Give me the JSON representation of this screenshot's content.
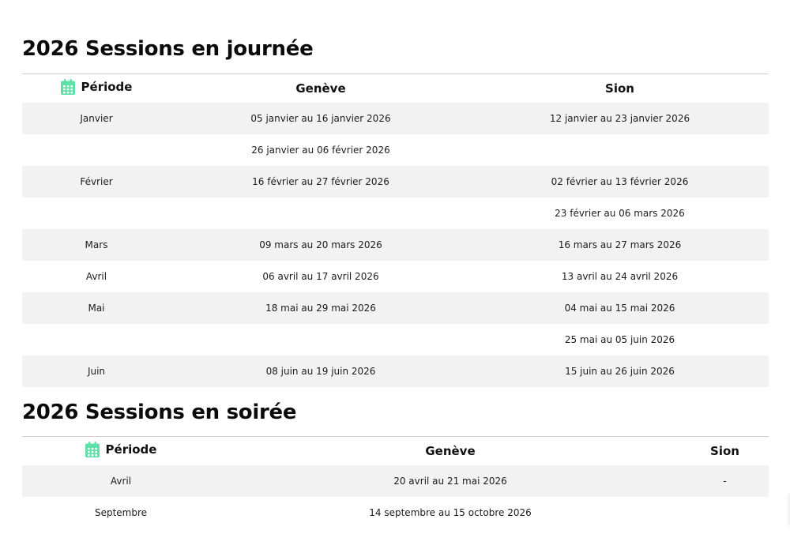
{
  "colors": {
    "accent": "#5fe0a8",
    "row_stripe": "#f2f2f2",
    "rule": "#cfcfcf"
  },
  "day": {
    "title": "2026 Sessions en journée",
    "headers": {
      "icon": "calendar-icon",
      "period": "Période",
      "geneve": "Genève",
      "sion": "Sion"
    },
    "rows": [
      [
        "Janvier",
        "05 janvier au 16 janvier 2026",
        "12 janvier au 23 janvier 2026"
      ],
      [
        "",
        "26 janvier au 06 février 2026",
        ""
      ],
      [
        "Février",
        "16 février au 27 février 2026",
        "02 février au 13 février 2026"
      ],
      [
        "",
        "",
        "23 février au 06 mars 2026"
      ],
      [
        "Mars",
        "09 mars au 20 mars 2026",
        "16 mars au 27 mars 2026"
      ],
      [
        "Avril",
        "06 avril au 17 avril 2026",
        "13 avril au 24 avril 2026"
      ],
      [
        "Mai",
        "18 mai au 29 mai 2026",
        "04 mai au 15 mai 2026"
      ],
      [
        "",
        "",
        "25 mai au 05 juin 2026"
      ],
      [
        "Juin",
        "08 juin au 19 juin 2026",
        "15 juin au 26 juin 2026"
      ]
    ]
  },
  "evening": {
    "title": "2026 Sessions en soirée",
    "headers": {
      "icon": "calendar-icon",
      "period": "Période",
      "geneve": "Genève",
      "sion": "Sion"
    },
    "rows": [
      [
        "Avril",
        "20 avril au 21 mai 2026",
        "-"
      ],
      [
        "Septembre",
        "14 septembre au 15 octobre 2026",
        ""
      ]
    ]
  }
}
